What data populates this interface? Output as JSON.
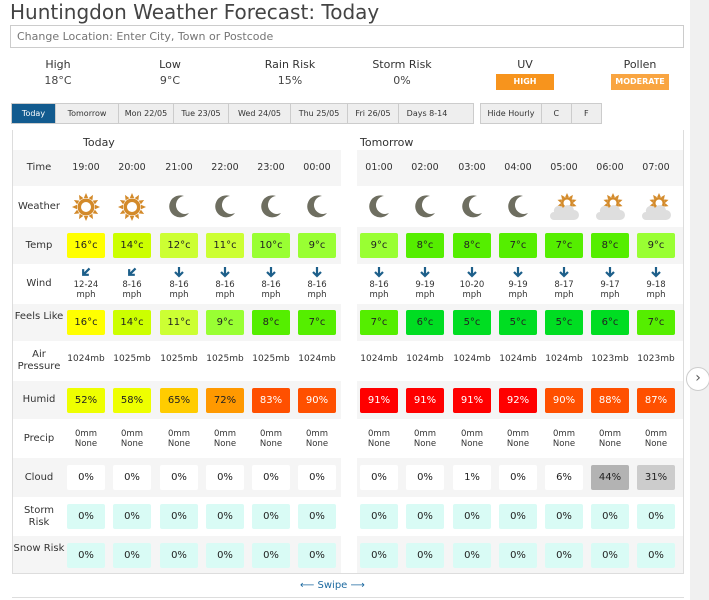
{
  "title": "Huntingdon Weather Forecast: Today",
  "location_placeholder": "Change Location: Enter City, Town or Postcode",
  "summary": [
    {
      "label": "High",
      "value": "18°C"
    },
    {
      "label": "Low",
      "value": "9°C"
    },
    {
      "label": "Rain Risk",
      "value": "15%"
    },
    {
      "label": "Storm Risk",
      "value": "0%"
    },
    {
      "label": "UV",
      "badge": "HIGH",
      "color": "#f7941d"
    },
    {
      "label": "Pollen",
      "badge": "MODERATE",
      "color": "#f9a541"
    }
  ],
  "day_tabs": [
    "Today",
    "Tomorrow",
    "Mon 22/05",
    "Tue 23/05",
    "Wed 24/05",
    "Thu 25/05",
    "Fri 26/05",
    "Days 8-14"
  ],
  "option_tabs": [
    "Hide Hourly",
    "C",
    "F"
  ],
  "row_labels": [
    "Time",
    "Weather",
    "Temp",
    "Wind",
    "Feels Like",
    "Air Pressure",
    "Humid",
    "Precip",
    "Cloud",
    "Storm Risk",
    "Snow Risk"
  ],
  "days": [
    {
      "label": "Today",
      "hours": [
        {
          "time": "19:00",
          "icon": "sun",
          "temp": "16°c",
          "tc": "#ffff00",
          "wdir": "sw",
          "wind": "12-24",
          "wunit": "mph",
          "feels": "16°c",
          "fc": "#ffff00",
          "press": "1024mb",
          "humid": "52%",
          "hc": "#eeff00",
          "pmm": "0mm",
          "ptype": "None",
          "cloud": "0%",
          "cc": "#ffffff",
          "storm": "0%",
          "snow": "0%"
        },
        {
          "time": "20:00",
          "icon": "sun",
          "temp": "14°c",
          "tc": "#ccff00",
          "wdir": "sw",
          "wind": "8-16",
          "wunit": "mph",
          "feels": "14°c",
          "fc": "#ccff00",
          "press": "1025mb",
          "humid": "58%",
          "hc": "#eeff00",
          "pmm": "0mm",
          "ptype": "None",
          "cloud": "0%",
          "cc": "#ffffff",
          "storm": "0%",
          "snow": "0%"
        },
        {
          "time": "21:00",
          "icon": "moon",
          "temp": "12°c",
          "tc": "#ccff33",
          "wdir": "s",
          "wind": "8-16",
          "wunit": "mph",
          "feels": "11°c",
          "fc": "#ccff33",
          "press": "1025mb",
          "humid": "65%",
          "hc": "#ffcc00",
          "pmm": "0mm",
          "ptype": "None",
          "cloud": "0%",
          "cc": "#ffffff",
          "storm": "0%",
          "snow": "0%"
        },
        {
          "time": "22:00",
          "icon": "moon",
          "temp": "11°c",
          "tc": "#ccff33",
          "wdir": "s",
          "wind": "8-16",
          "wunit": "mph",
          "feels": "9°c",
          "fc": "#99ff33",
          "press": "1025mb",
          "humid": "72%",
          "hc": "#ff9900",
          "pmm": "0mm",
          "ptype": "None",
          "cloud": "0%",
          "cc": "#ffffff",
          "storm": "0%",
          "snow": "0%"
        },
        {
          "time": "23:00",
          "icon": "moon",
          "temp": "10°c",
          "tc": "#99ff33",
          "wdir": "s",
          "wind": "8-16",
          "wunit": "mph",
          "feels": "8°c",
          "fc": "#55ee00",
          "press": "1025mb",
          "humid": "83%",
          "hc": "#ff5000",
          "pmm": "0mm",
          "ptype": "None",
          "cloud": "0%",
          "cc": "#ffffff",
          "storm": "0%",
          "snow": "0%"
        },
        {
          "time": "00:00",
          "icon": "moon",
          "temp": "9°c",
          "tc": "#99ff33",
          "wdir": "s",
          "wind": "8-16",
          "wunit": "mph",
          "feels": "7°c",
          "fc": "#55ee00",
          "press": "1024mb",
          "humid": "90%",
          "hc": "#ff5000",
          "pmm": "0mm",
          "ptype": "None",
          "cloud": "0%",
          "cc": "#ffffff",
          "storm": "0%",
          "snow": "0%"
        }
      ]
    },
    {
      "label": "Tomorrow",
      "hours": [
        {
          "time": "01:00",
          "icon": "moon",
          "temp": "9°c",
          "tc": "#99ff33",
          "wdir": "s",
          "wind": "8-16",
          "wunit": "mph",
          "feels": "7°c",
          "fc": "#55ee00",
          "press": "1024mb",
          "humid": "91%",
          "hc": "#ff0000",
          "pmm": "0mm",
          "ptype": "None",
          "cloud": "0%",
          "cc": "#ffffff",
          "storm": "0%",
          "snow": "0%"
        },
        {
          "time": "02:00",
          "icon": "moon",
          "temp": "8°c",
          "tc": "#55ee00",
          "wdir": "s",
          "wind": "9-19",
          "wunit": "mph",
          "feels": "6°c",
          "fc": "#00dd22",
          "press": "1024mb",
          "humid": "91%",
          "hc": "#ff0000",
          "pmm": "0mm",
          "ptype": "None",
          "cloud": "0%",
          "cc": "#ffffff",
          "storm": "0%",
          "snow": "0%"
        },
        {
          "time": "03:00",
          "icon": "moon",
          "temp": "8°c",
          "tc": "#55ee00",
          "wdir": "s",
          "wind": "10-20",
          "wunit": "mph",
          "feels": "5°c",
          "fc": "#00dd22",
          "press": "1024mb",
          "humid": "91%",
          "hc": "#ff0000",
          "pmm": "0mm",
          "ptype": "None",
          "cloud": "1%",
          "cc": "#ffffff",
          "storm": "0%",
          "snow": "0%"
        },
        {
          "time": "04:00",
          "icon": "moon",
          "temp": "7°c",
          "tc": "#55ee00",
          "wdir": "s",
          "wind": "9-19",
          "wunit": "mph",
          "feels": "5°c",
          "fc": "#00dd22",
          "press": "1024mb",
          "humid": "92%",
          "hc": "#ff0000",
          "pmm": "0mm",
          "ptype": "None",
          "cloud": "0%",
          "cc": "#ffffff",
          "storm": "0%",
          "snow": "0%"
        },
        {
          "time": "05:00",
          "icon": "sun-cloud",
          "temp": "7°c",
          "tc": "#55ee00",
          "wdir": "s",
          "wind": "8-17",
          "wunit": "mph",
          "feels": "5°c",
          "fc": "#00dd22",
          "press": "1024mb",
          "humid": "90%",
          "hc": "#ff5000",
          "pmm": "0mm",
          "ptype": "None",
          "cloud": "6%",
          "cc": "#ffffff",
          "storm": "0%",
          "snow": "0%"
        },
        {
          "time": "06:00",
          "icon": "sun-cloud",
          "temp": "8°c",
          "tc": "#55ee00",
          "wdir": "s",
          "wind": "9-17",
          "wunit": "mph",
          "feels": "6°c",
          "fc": "#00dd22",
          "press": "1023mb",
          "humid": "88%",
          "hc": "#ff5000",
          "pmm": "0mm",
          "ptype": "None",
          "cloud": "44%",
          "cc": "#b3b3b3",
          "storm": "0%",
          "snow": "0%"
        },
        {
          "time": "07:00",
          "icon": "sun-cloud",
          "temp": "9°c",
          "tc": "#99ff33",
          "wdir": "s",
          "wind": "9-18",
          "wunit": "mph",
          "feels": "7°c",
          "fc": "#55ee00",
          "press": "1023mb",
          "humid": "87%",
          "hc": "#ff5000",
          "pmm": "0mm",
          "ptype": "None",
          "cloud": "31%",
          "cc": "#cccccc",
          "storm": "0%",
          "snow": "0%"
        }
      ]
    }
  ],
  "risk_color": "#d9fbf5",
  "swipe": "Swipe",
  "next_icon": "chevron-right-icon"
}
